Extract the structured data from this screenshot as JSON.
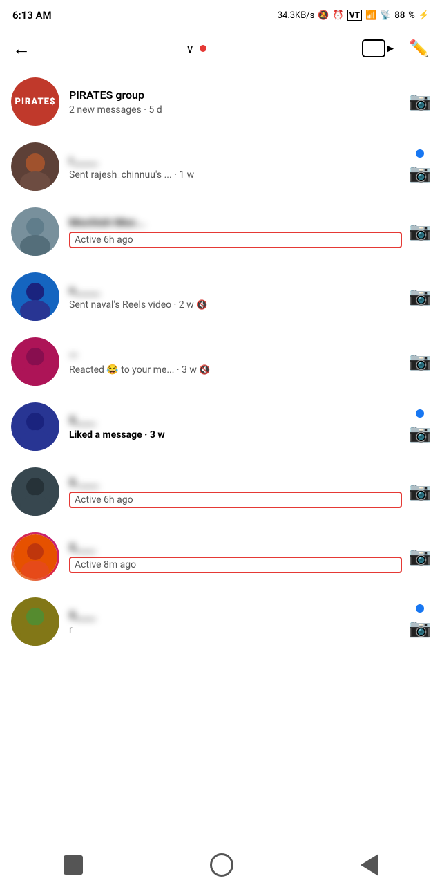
{
  "statusBar": {
    "time": "6:13 AM",
    "speed": "34.3KB/s",
    "battery": "88"
  },
  "nav": {
    "chevron": "∨",
    "videoCallLabel": "video-call",
    "editLabel": "edit"
  },
  "conversations": [
    {
      "id": "conv-1",
      "name": "PIRATES group",
      "nameBlurred": false,
      "preview": "2 new messages · 5 d",
      "previewBold": false,
      "activeStatus": null,
      "hasUnread": false,
      "isMuted": false,
      "avatarType": "pirates",
      "avatarBg": "pirates"
    },
    {
      "id": "conv-2",
      "name": "r",
      "nameBlurred": true,
      "preview": "Sent rajesh_chinnuu's ... · 1 w",
      "previewBold": false,
      "activeStatus": null,
      "hasUnread": true,
      "isMuted": false,
      "avatarType": "photo",
      "avatarBg": "av-brown"
    },
    {
      "id": "conv-3",
      "name": "Mochish Moc...",
      "nameBlurred": true,
      "preview": null,
      "previewBold": false,
      "activeStatus": "Active 6h ago",
      "hasUnread": false,
      "isMuted": false,
      "avatarType": "photo",
      "avatarBg": "av-gray"
    },
    {
      "id": "conv-4",
      "name": "n",
      "nameBlurred": true,
      "preview": "Sent naval's Reels video · 2 w",
      "previewBold": false,
      "activeStatus": null,
      "hasUnread": false,
      "isMuted": true,
      "avatarType": "photo",
      "avatarBg": "av-blue"
    },
    {
      "id": "conv-5",
      "name": "—",
      "nameBlurred": true,
      "preview": "Reacted 😂 to your me... · 3 w",
      "previewBold": false,
      "activeStatus": null,
      "hasUnread": false,
      "isMuted": true,
      "avatarType": "photo",
      "avatarBg": "av-pink"
    },
    {
      "id": "conv-6",
      "name": "S",
      "nameBlurred": true,
      "preview": "Liked a message · 3 w",
      "previewBold": true,
      "activeStatus": null,
      "hasUnread": true,
      "isMuted": false,
      "avatarType": "photo",
      "avatarBg": "av-navy"
    },
    {
      "id": "conv-7",
      "name": "S.",
      "nameBlurred": true,
      "preview": null,
      "previewBold": false,
      "activeStatus": "Active 6h ago",
      "hasUnread": false,
      "isMuted": false,
      "avatarType": "photo",
      "avatarBg": "av-dark"
    },
    {
      "id": "conv-8",
      "name": "S",
      "nameBlurred": true,
      "preview": null,
      "previewBold": false,
      "activeStatus": "Active 8m ago",
      "hasUnread": false,
      "isMuted": false,
      "avatarType": "photo",
      "avatarBg": "av-orange",
      "hasStoryRing": true
    },
    {
      "id": "conv-9",
      "name": "S",
      "nameBlurred": true,
      "preview": "r",
      "previewBold": false,
      "activeStatus": null,
      "hasUnread": true,
      "isMuted": false,
      "avatarType": "photo",
      "avatarBg": "av-olive"
    }
  ],
  "bottomNav": {
    "squareLabel": "back",
    "circleLabel": "home",
    "triangleLabel": "back-button"
  }
}
